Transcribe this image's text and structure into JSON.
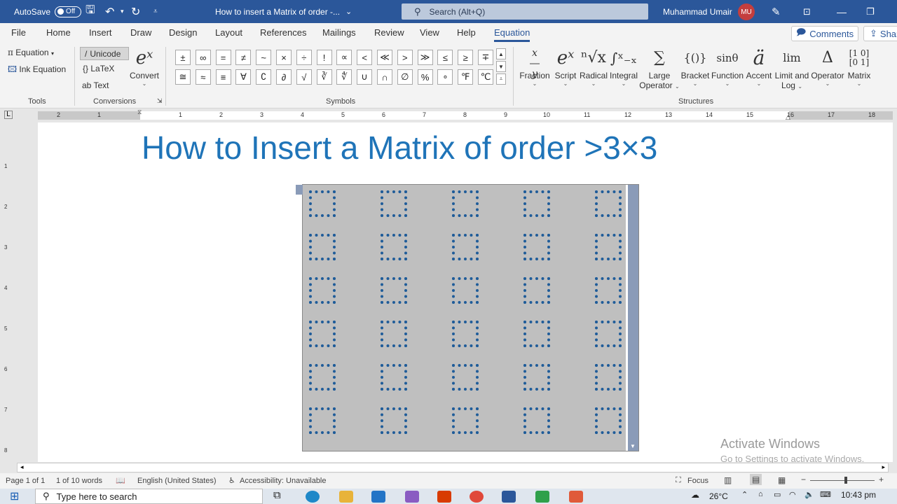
{
  "titlebar": {
    "autosave_label": "AutoSave",
    "autosave_state": "Off",
    "doc_title": "How to insert a Matrix of order -...",
    "search_placeholder": "Search (Alt+Q)",
    "user_name": "Muhammad Umair",
    "user_initials": "MU"
  },
  "tabs": [
    "File",
    "Home",
    "Insert",
    "Draw",
    "Design",
    "Layout",
    "References",
    "Mailings",
    "Review",
    "View",
    "Help",
    "Equation"
  ],
  "active_tab": "Equation",
  "comments_label": "Comments",
  "share_label": "Shar",
  "ribbon": {
    "tools": {
      "equation": "Equation",
      "ink": "Ink Equation",
      "label": "Tools"
    },
    "conversions": {
      "unicode": "Unicode",
      "latex": "LaTeX",
      "text": "Text",
      "convert": "Convert",
      "label": "Conversions"
    },
    "symbols": {
      "row1": [
        "±",
        "∞",
        "=",
        "≠",
        "~",
        "×",
        "÷",
        "!",
        "∝",
        "<",
        "≪",
        ">",
        "≫",
        "≤",
        "≥",
        "∓"
      ],
      "row2": [
        "≅",
        "≈",
        "≡",
        "∀",
        "∁",
        "∂",
        "√",
        "∛",
        "∜",
        "∪",
        "∩",
        "∅",
        "%",
        "∘",
        "℉",
        "℃"
      ],
      "label": "Symbols"
    },
    "structures": {
      "items": [
        {
          "name": "Fraction",
          "glyph": "x/y"
        },
        {
          "name": "Script",
          "glyph": "eˣ"
        },
        {
          "name": "Radical",
          "glyph": "ⁿ√x"
        },
        {
          "name": "Integral",
          "glyph": "∫ˣ₋ₓ"
        },
        {
          "name": "Large",
          "name2": "Operator",
          "glyph": "∑"
        },
        {
          "name": "Bracket",
          "glyph": "{()}"
        },
        {
          "name": "Function",
          "glyph": "sinθ"
        },
        {
          "name": "Accent",
          "glyph": "ä"
        },
        {
          "name": "Limit and",
          "name2": "Log",
          "glyph": "lim"
        },
        {
          "name": "Operator",
          "glyph": "Δ"
        },
        {
          "name": "Matrix",
          "glyph": "[10/01]"
        }
      ],
      "label": "Structures"
    }
  },
  "ruler_numbers": [
    "2",
    "1",
    "1",
    "2",
    "3",
    "4",
    "5",
    "6",
    "7",
    "8",
    "9",
    "10",
    "11",
    "12",
    "13",
    "14",
    "15",
    "16",
    "17",
    "18"
  ],
  "vruler_numbers": [
    "1",
    "2",
    "3",
    "4",
    "5",
    "6",
    "7",
    "8",
    "9"
  ],
  "document": {
    "title": "How to Insert a Matrix of order >3×3",
    "matrix": {
      "rows": 6,
      "cols": 5
    }
  },
  "watermark": {
    "line1": "Activate Windows",
    "line2": "Go to Settings to activate Windows."
  },
  "status": {
    "page": "Page 1 of 1",
    "words": "1 of 10 words",
    "language": "English (United States)",
    "accessibility": "Accessibility: Unavailable",
    "focus": "Focus"
  },
  "taskbar": {
    "search_placeholder": "Type here to search",
    "temperature": "26°C",
    "time": "10:43 pm"
  }
}
